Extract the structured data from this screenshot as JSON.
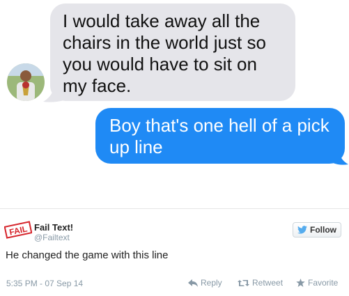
{
  "chat": {
    "incoming_message": "I would take away all the chairs in the world just so you would have to sit on my face.",
    "outgoing_message": "Boy that's one hell of a pick up line"
  },
  "tweet": {
    "logo_text": "FAIL",
    "display_name": "Fail Text!",
    "handle": "@Failtext",
    "follow_label": "Follow",
    "text": "He changed the game with this line",
    "timestamp": "5:35 PM - 07 Sep 14",
    "actions": {
      "reply": "Reply",
      "retweet": "Retweet",
      "favorite": "Favorite"
    }
  },
  "colors": {
    "incoming_bubble": "#e5e5ea",
    "outgoing_bubble": "#1f8af5",
    "twitter_blue": "#55acee",
    "fail_red": "#d6242b"
  }
}
